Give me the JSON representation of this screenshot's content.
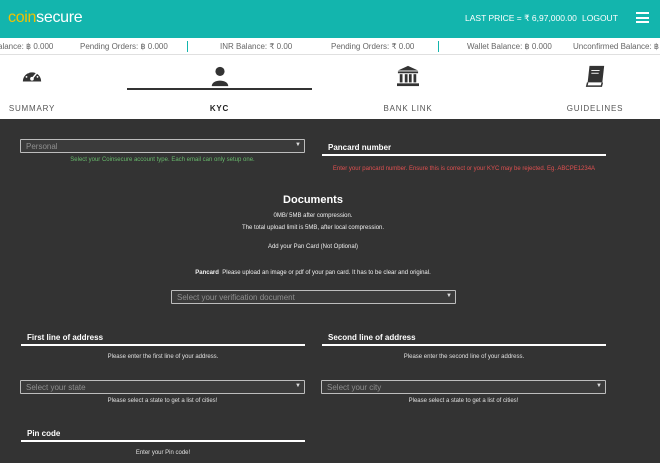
{
  "header": {
    "logo_part1": "coin",
    "logo_part2": "secure",
    "last_price": "LAST PRICE = ₹ 6,97,000.00",
    "logout": "LOGOUT"
  },
  "ticker": [
    {
      "text": "alance: ฿ 0.000"
    },
    {
      "text": "Pending Orders: ฿ 0.000"
    },
    {
      "text": "INR Balance:  ₹ 0.00"
    },
    {
      "text": "Pending Orders:  ₹ 0.00"
    },
    {
      "text": "Wallet Balance: ฿ 0.000"
    },
    {
      "text": "Unconfirmed Balance: ฿ 0"
    }
  ],
  "tabs": [
    {
      "label": "SUMMARY",
      "icon": "gauge-icon"
    },
    {
      "label": "KYC",
      "icon": "user-icon"
    },
    {
      "label": "BANK LINK",
      "icon": "bank-icon"
    },
    {
      "label": "GUIDELINES",
      "icon": "book-icon"
    }
  ],
  "form": {
    "account_type_value": "Personal",
    "account_type_help": "Select your Coinsecure account type. Each email can only setup one.",
    "pancard_heading": "Pancard number",
    "pancard_help": "Enter your pancard number. Ensure this is correct or your KYC may be rejected. Eg. ABCPE1234A",
    "documents_title": "Documents",
    "size_info": "0MB/ 5MB after compression.",
    "upload_limit": "The total upload limit is 5MB, after local compression.",
    "add_pan": "Add your Pan Card (Not Optional)",
    "pancard_label": "Pancard",
    "pancard_upload_help": "Please upload an image or pdf of your pan card. It has to be clear and original.",
    "verification_placeholder": "Select your verification document",
    "address1_heading": "First line of address",
    "address1_help": "Please enter the first line of your address.",
    "address2_heading": "Second line of address",
    "address2_help": "Please enter the second line of your address.",
    "state_placeholder": "Select your state",
    "state_help": "Please select a state to get a list of cities!",
    "city_placeholder": "Select your city",
    "city_help": "Please select a state to get a list of cities!",
    "pin_heading": "Pin code",
    "pin_help": "Enter your Pin code!"
  },
  "colors": {
    "header": "#13b5ad",
    "logo_accent": "#f2c200",
    "background": "#333333"
  }
}
